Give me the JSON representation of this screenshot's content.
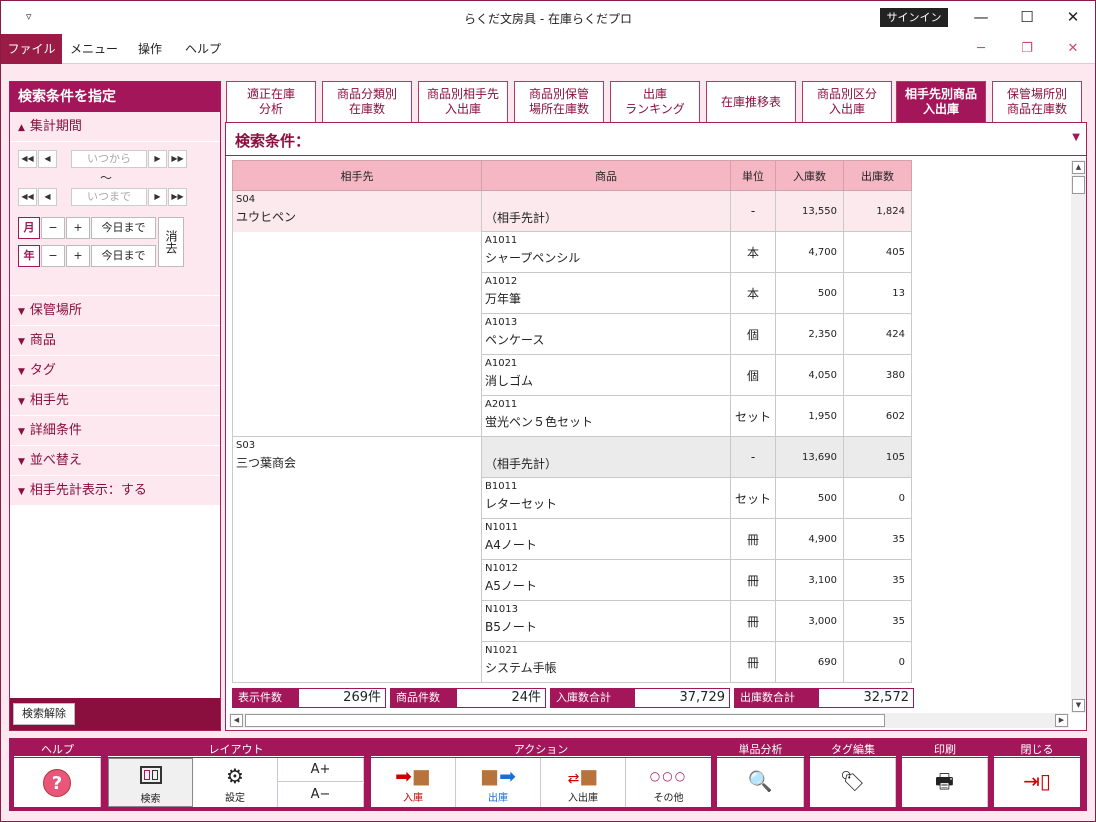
{
  "window": {
    "title": "らくだ文房具 - 在庫らくだプロ",
    "quick_access": "▿",
    "signin": "サインイン",
    "min": "—",
    "max": "☐",
    "close": "✕"
  },
  "menu": {
    "items": [
      "ファイル",
      "メニュー",
      "操作",
      "ヘルプ"
    ],
    "min": "─",
    "restore": "❐",
    "close": "✕"
  },
  "left_panel": {
    "title": "検索条件を指定",
    "period_label": "集計期間",
    "from_placeholder": "いつから",
    "tilde": "〜",
    "to_placeholder": "いつまで",
    "month": "月",
    "year": "年",
    "minus": "−",
    "plus": "+",
    "today": "今日まで",
    "clear": "消去",
    "sections": [
      "保管場所",
      "商品",
      "タグ",
      "相手先",
      "詳細条件",
      "並べ替え",
      "相手先計表示：する"
    ],
    "clear_search": "検索解除"
  },
  "tabs": [
    {
      "l1": "適正在庫",
      "l2": "分析"
    },
    {
      "l1": "商品分類別",
      "l2": "在庫数"
    },
    {
      "l1": "商品別相手先",
      "l2": "入出庫"
    },
    {
      "l1": "商品別保管",
      "l2": "場所在庫数"
    },
    {
      "l1": "出庫",
      "l2": "ランキング"
    },
    {
      "l1": "在庫推移表",
      "l2": ""
    },
    {
      "l1": "商品別区分",
      "l2": "入出庫"
    },
    {
      "l1": "相手先別商品",
      "l2": "入出庫"
    },
    {
      "l1": "保管場所別",
      "l2": "商品在庫数"
    }
  ],
  "condition_label": "検索条件：",
  "table": {
    "headers": [
      "相手先",
      "商品",
      "単位",
      "入庫数",
      "出庫数"
    ],
    "groups": [
      {
        "code": "S04",
        "name": "ユウヒペン",
        "rows": [
          {
            "code": "",
            "name": "（相手先計）",
            "unit": "-",
            "in": "13,550",
            "out": "1,824"
          },
          {
            "code": "A1011",
            "name": "シャープペンシル",
            "unit": "本",
            "in": "4,700",
            "out": "405"
          },
          {
            "code": "A1012",
            "name": "万年筆",
            "unit": "本",
            "in": "500",
            "out": "13"
          },
          {
            "code": "A1013",
            "name": "ペンケース",
            "unit": "個",
            "in": "2,350",
            "out": "424"
          },
          {
            "code": "A1021",
            "name": "消しゴム",
            "unit": "個",
            "in": "4,050",
            "out": "380"
          },
          {
            "code": "A2011",
            "name": "蛍光ペン５色セット",
            "unit": "セット",
            "in": "1,950",
            "out": "602"
          }
        ]
      },
      {
        "code": "S03",
        "name": "三つ葉商会",
        "rows": [
          {
            "code": "",
            "name": "（相手先計）",
            "unit": "-",
            "in": "13,690",
            "out": "105"
          },
          {
            "code": "B1011",
            "name": "レターセット",
            "unit": "セット",
            "in": "500",
            "out": "0"
          },
          {
            "code": "N1011",
            "name": "A4ノート",
            "unit": "冊",
            "in": "4,900",
            "out": "35"
          },
          {
            "code": "N1012",
            "name": "A5ノート",
            "unit": "冊",
            "in": "3,100",
            "out": "35"
          },
          {
            "code": "N1013",
            "name": "B5ノート",
            "unit": "冊",
            "in": "3,000",
            "out": "35"
          },
          {
            "code": "N1021",
            "name": "システム手帳",
            "unit": "冊",
            "in": "690",
            "out": "0"
          }
        ]
      }
    ]
  },
  "summary": {
    "display_count_label": "表示件数",
    "display_count": "269件",
    "item_count_label": "商品件数",
    "item_count": "24件",
    "in_total_label": "入庫数合計",
    "in_total": "37,729",
    "out_total_label": "出庫数合計",
    "out_total": "32,572"
  },
  "toolbar": {
    "groups": {
      "help": "ヘルプ",
      "layout": "レイアウト",
      "action": "アクション",
      "single": "単品分析",
      "tag": "タグ編集",
      "print": "印刷",
      "close": "閉じる"
    },
    "search": "検索",
    "settings": "設定",
    "font_up": "A+",
    "font_down": "A−",
    "in": "入庫",
    "out": "出庫",
    "inout": "入出庫",
    "other": "その他",
    "help_icon": "?"
  },
  "colors": {
    "accent": "#a3175a",
    "header": "#f5b7c4",
    "panel": "#fce8ee"
  }
}
